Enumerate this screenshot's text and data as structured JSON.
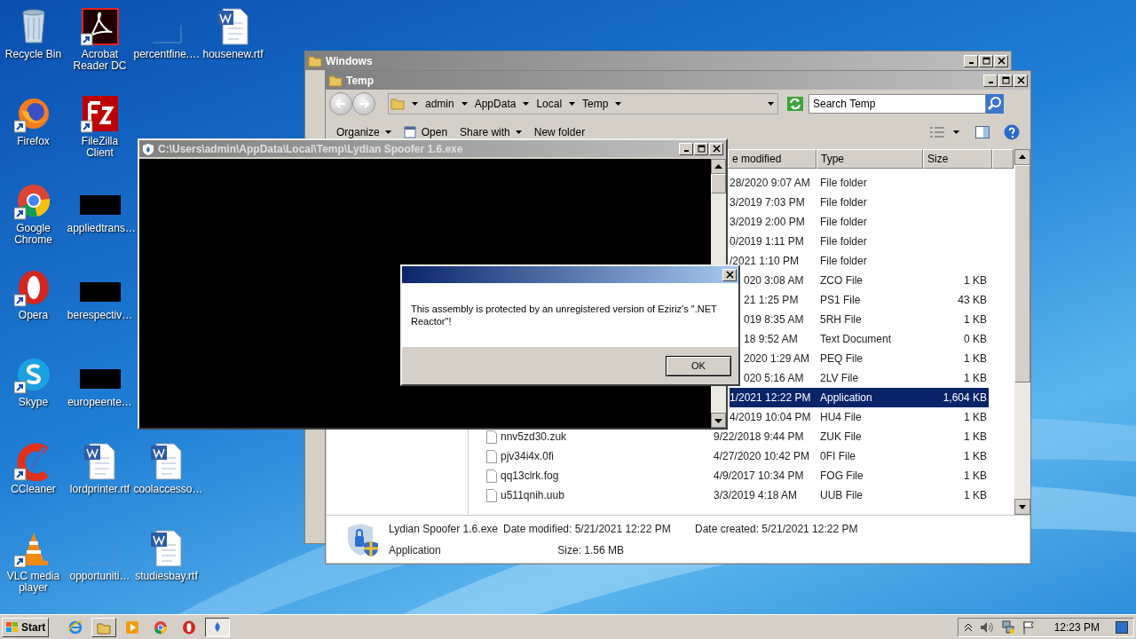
{
  "desktop": {
    "icons": [
      {
        "label": "Recycle Bin",
        "kind": "recycle",
        "shortcut": false
      },
      {
        "label": "Firefox",
        "kind": "firefox",
        "shortcut": true
      },
      {
        "label": "Google Chrome",
        "kind": "chrome",
        "shortcut": true
      },
      {
        "label": "Opera",
        "kind": "opera",
        "shortcut": true
      },
      {
        "label": "Skype",
        "kind": "skype",
        "shortcut": true
      },
      {
        "label": "CCleaner",
        "kind": "ccleaner",
        "shortcut": true
      },
      {
        "label": "VLC media player",
        "kind": "vlc",
        "shortcut": true
      },
      {
        "label": "Acrobat Reader DC",
        "kind": "acrobat",
        "shortcut": true
      },
      {
        "label": "FileZilla Client",
        "kind": "filezilla",
        "shortcut": true
      },
      {
        "label": "appliedtrans…",
        "kind": "black",
        "shortcut": false
      },
      {
        "label": "berespectiv…",
        "kind": "black",
        "shortcut": false
      },
      {
        "label": "europeente…",
        "kind": "black",
        "shortcut": false
      },
      {
        "label": "lordprinter.rtf",
        "kind": "word",
        "shortcut": false
      },
      {
        "label": "opportuniti…",
        "kind": "blank",
        "shortcut": false
      },
      {
        "label": "percentfine.…",
        "kind": "blank",
        "shortcut": false
      },
      {
        "label": "coolaccesso…",
        "kind": "word",
        "shortcut": false
      },
      {
        "label": "studiesbay.rtf",
        "kind": "word",
        "shortcut": false
      },
      {
        "label": "housenew.rtf",
        "kind": "word",
        "shortcut": false
      }
    ]
  },
  "back_window": {
    "title": "Windows"
  },
  "explorer": {
    "title": "Temp",
    "breadcrumb": [
      "admin",
      "AppData",
      "Local",
      "Temp"
    ],
    "search": {
      "placeholder": "Search Temp"
    },
    "toolbar": [
      {
        "label": "Organize",
        "kind": "menu"
      },
      {
        "label": "Open",
        "kind": "open"
      },
      {
        "label": "Share with",
        "kind": "menu"
      },
      {
        "label": "New folder",
        "kind": "plain"
      }
    ],
    "columns": [
      "e modified",
      "Type",
      "Size"
    ],
    "rows": [
      {
        "modified": "28/2020 9:07 AM",
        "type": "File folder",
        "selected": false
      },
      {
        "modified": "3/2019 7:03 PM",
        "type": "File folder",
        "selected": false
      },
      {
        "modified": "3/2019 2:00 PM",
        "type": "File folder",
        "selected": false
      },
      {
        "modified": "0/2019 1:11 PM",
        "type": "File folder",
        "selected": false
      },
      {
        "modified": "/2021 1:10 PM",
        "type": "File folder",
        "selected": false
      },
      {
        "modified": "020 3:08 AM",
        "type": "ZCO File",
        "size": "1 KB",
        "selected": false
      },
      {
        "modified": "21 1:25 PM",
        "type": "PS1 File",
        "size": "43 KB",
        "selected": false
      },
      {
        "modified": "019 8:35 AM",
        "type": "5RH File",
        "size": "1 KB",
        "selected": false
      },
      {
        "modified": "18 9:52 AM",
        "type": "Text Document",
        "size": "0 KB",
        "selected": false
      },
      {
        "modified": "2020 1:29 AM",
        "type": "PEQ File",
        "size": "1 KB",
        "selected": false
      },
      {
        "modified": "020 5:16 AM",
        "type": "2LV File",
        "size": "1 KB",
        "selected": false
      },
      {
        "modified": "1/2021 12:22 PM",
        "type": "Application",
        "size": "1,604 KB",
        "selected": true
      },
      {
        "modified": "4/2019 10:04 PM",
        "type": "HU4 File",
        "size": "1 KB",
        "selected": false
      },
      {
        "name": "nnv5zd30.zuk",
        "modified": "9/22/2018 9:44 PM",
        "type": "ZUK File",
        "size": "1 KB",
        "selected": false
      },
      {
        "name": "pjv34i4x.0fi",
        "modified": "4/27/2020 10:42 PM",
        "type": "0FI File",
        "size": "1 KB",
        "selected": false
      },
      {
        "name": "qq13clrk.fog",
        "modified": "4/9/2017 10:34 PM",
        "type": "FOG File",
        "size": "1 KB",
        "selected": false
      },
      {
        "name": "u511qnih.uub",
        "modified": "3/3/2019 4:18 AM",
        "type": "UUB File",
        "size": "1 KB",
        "selected": false
      }
    ],
    "details": {
      "name": "Lydian Spoofer 1.6.exe",
      "modified": "Date modified: 5/21/2021 12:22 PM",
      "created": "Date created: 5/21/2021 12:22 PM",
      "type": "Application",
      "size": "Size: 1.56 MB"
    }
  },
  "console": {
    "title": "C:\\Users\\admin\\AppData\\Local\\Temp\\Lydian Spoofer 1.6.exe"
  },
  "dialog": {
    "message": "This assembly is protected by an unregistered version of Eziriz's \".NET Reactor\"!",
    "button": "OK"
  },
  "taskbar": {
    "start": "Start",
    "apps": [
      {
        "kind": "ie",
        "active": false
      },
      {
        "kind": "folder",
        "active": false
      },
      {
        "kind": "media",
        "active": false
      },
      {
        "kind": "chrome",
        "active": false
      },
      {
        "kind": "opera",
        "active": false
      },
      {
        "kind": "app",
        "active": true
      }
    ],
    "clock": "12:23 PM"
  }
}
